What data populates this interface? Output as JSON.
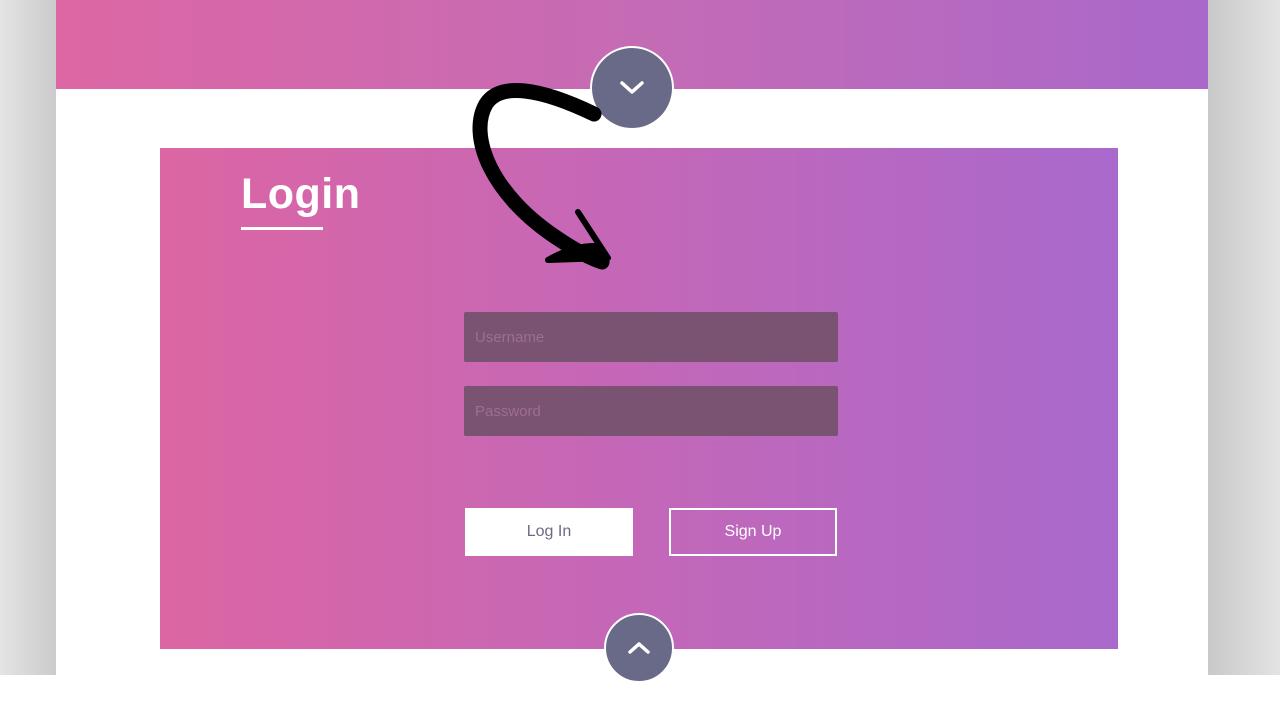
{
  "login": {
    "title": "Login",
    "username_placeholder": "Username",
    "password_placeholder": "Password",
    "login_label": "Log In",
    "signup_label": "Sign Up"
  },
  "colors": {
    "gradient_start": "#dc66a3",
    "gradient_mid": "#c667b6",
    "gradient_end": "#a969cc",
    "field_bg": "#7a5272",
    "circle_button": "#696a88"
  },
  "icons": {
    "scroll_down": "chevron-down-icon",
    "scroll_up": "chevron-up-icon",
    "annotation": "curved-arrow-icon"
  }
}
